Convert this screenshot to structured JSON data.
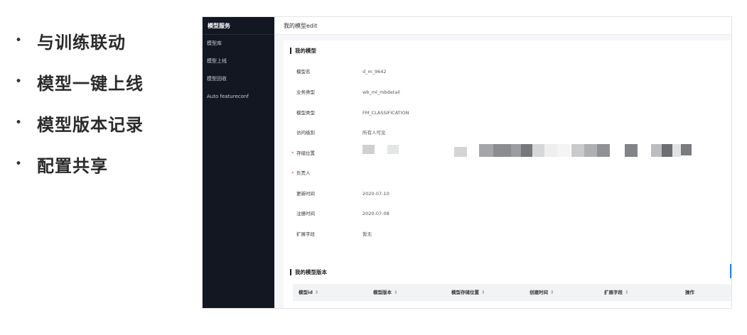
{
  "slide": {
    "bullets": [
      "与训练联动",
      "模型一键上线",
      "模型版本记录",
      "配置共享"
    ]
  },
  "app": {
    "sidebar": {
      "title": "模型服务",
      "items": [
        "模型库",
        "模型上线",
        "模型回收",
        "Auto featureconf"
      ]
    },
    "page_title": "我的模型edit",
    "model_card": {
      "title": "我的模型",
      "fields": [
        {
          "label": "模型名",
          "value": "d_m_9642",
          "required": false
        },
        {
          "label": "业务类型",
          "value": "wb_ml_mbdetail",
          "required": false
        },
        {
          "label": "模型类型",
          "value": "FM_CLASSIFICATION",
          "required": false
        },
        {
          "label": "访问级别",
          "value": "所有人可见",
          "required": false
        },
        {
          "label": "存储位置",
          "value": "",
          "required": true
        },
        {
          "label": "负责人",
          "value": "",
          "required": true
        },
        {
          "label": "更新时间",
          "value": "2020-07-10",
          "required": false
        },
        {
          "label": "注册时间",
          "value": "2020-07-08",
          "required": false
        },
        {
          "label": "扩展字段",
          "value": "暂无",
          "required": false
        }
      ]
    },
    "version_card": {
      "title": "我的模型版本",
      "columns": [
        "模型id",
        "模型版本",
        "模型存储位置",
        "创建时间",
        "扩展字段",
        "操作"
      ],
      "sort_icon": "⇕"
    }
  },
  "colors": {
    "sidebar_bg": "#131722",
    "required_mark": "#e34d3f",
    "accent": "#2d7cf0"
  }
}
